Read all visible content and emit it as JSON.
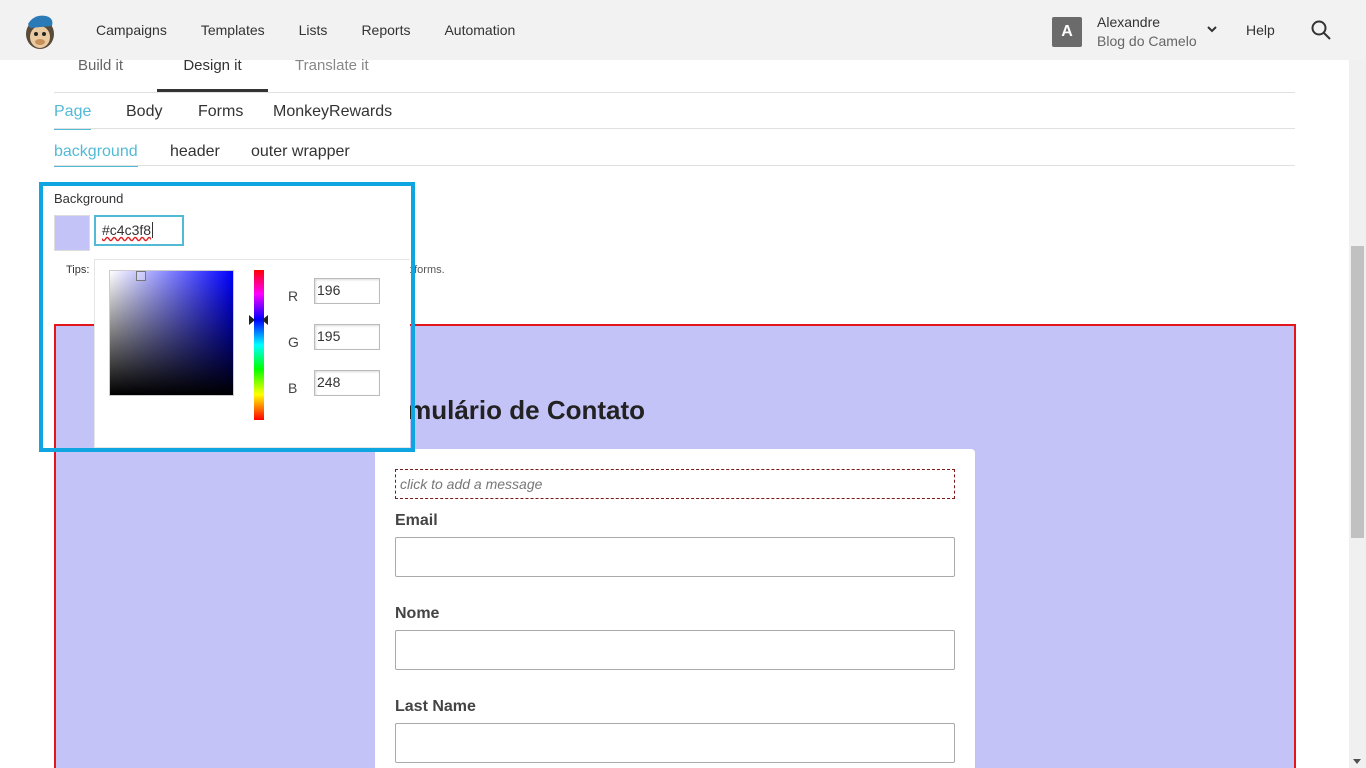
{
  "nav": {
    "items": [
      "Campaigns",
      "Templates",
      "Lists",
      "Reports",
      "Automation"
    ],
    "user_initial": "A",
    "user_name": "Alexandre",
    "user_org": "Blog do Camelo",
    "help": "Help"
  },
  "steps": [
    "Build it",
    "Design it",
    "Translate it"
  ],
  "design_tabs": [
    "Page",
    "Body",
    "Forms",
    "MonkeyRewards"
  ],
  "page_tabs": [
    "background",
    "header",
    "outer wrapper"
  ],
  "background": {
    "label": "Background",
    "hex_value": "#c4c3f8",
    "tips_prefix": "Tips:",
    "tips_tail": "t forms.",
    "rgb": {
      "r_label": "R",
      "r_value": "196",
      "g_label": "G",
      "g_value": "195",
      "b_label": "B",
      "b_value": "248"
    }
  },
  "form": {
    "title": "rmulário de Contato",
    "message_placeholder": "click to add a message",
    "fields": [
      "Email",
      "Nome",
      "Last Name"
    ]
  },
  "colors": {
    "accent": "#52bad5",
    "highlight": "#0ea5e0",
    "preview_bg": "#c4c3f8",
    "preview_border": "#e3161c"
  }
}
